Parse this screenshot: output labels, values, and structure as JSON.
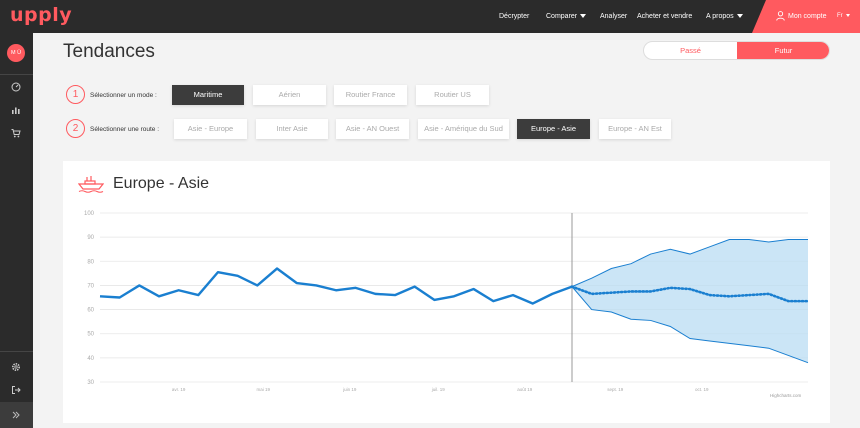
{
  "app": {
    "logo": "upply"
  },
  "topnav": {
    "items": [
      {
        "label": "Décrypter",
        "dropdown": false
      },
      {
        "label": "Comparer",
        "dropdown": true
      },
      {
        "label": "Analyser",
        "dropdown": false
      },
      {
        "label": "Acheter et vendre",
        "dropdown": false
      },
      {
        "label": "A propos",
        "dropdown": true
      }
    ],
    "account_label": "Mon compte",
    "language": "Fr"
  },
  "sidebar": {
    "avatar_initials": "M Ü",
    "icons": [
      "speedometer-icon",
      "bar-chart-icon",
      "cart-icon",
      "settings-icon",
      "logout-icon",
      "expand-icon"
    ]
  },
  "page": {
    "title": "Tendances"
  },
  "period_toggle": {
    "past_label": "Passé",
    "future_label": "Futur",
    "selected": "Futur"
  },
  "mode_selector": {
    "step": "1",
    "label": "Sélectionner un mode :",
    "options": [
      "Maritime",
      "Aérien",
      "Routier France",
      "Routier US"
    ],
    "selected": "Maritime"
  },
  "route_selector": {
    "step": "2",
    "label": "Sélectionner une route :",
    "options": [
      "Asie - Europe",
      "Inter Asie",
      "Asie - AN Ouest",
      "Asie - Amérique du Sud",
      "Europe - Asie",
      "Europe - AN Est"
    ],
    "selected": "Europe - Asie"
  },
  "chart_card": {
    "title": "Europe - Asie",
    "credit": "Highcharts.com"
  },
  "colors": {
    "accent": "#ff5a5f",
    "series": "#1a7fd0",
    "band": "#b9dcf3",
    "dark": "#2b2b2b"
  },
  "chart_data": {
    "type": "line",
    "title": "Europe - Asie",
    "ylim": [
      30,
      100
    ],
    "y_ticks": [
      30,
      40,
      50,
      60,
      70,
      80,
      90,
      100
    ],
    "xlim": [
      0,
      36
    ],
    "x_ticks": [
      {
        "x": 4,
        "label": "avr. 19"
      },
      {
        "x": 8.3,
        "label": "mai 19"
      },
      {
        "x": 12.7,
        "label": "juin 19"
      },
      {
        "x": 17.2,
        "label": "juil. 19"
      },
      {
        "x": 21.6,
        "label": "août 19"
      },
      {
        "x": 26.2,
        "label": "sept. 19"
      },
      {
        "x": 30.6,
        "label": "oct. 19"
      }
    ],
    "forecast_start_x": 24,
    "series": [
      {
        "style": "solid",
        "x": [
          0,
          1,
          2,
          3,
          4,
          5,
          6,
          7,
          8,
          9,
          10,
          11,
          12,
          13,
          14,
          15,
          16,
          17,
          18,
          19,
          20,
          21,
          22,
          23,
          24
        ],
        "values": [
          65.5,
          65,
          70,
          65.5,
          68,
          66,
          75.5,
          74,
          70,
          77,
          71,
          70,
          68,
          69,
          66.5,
          66,
          69.5,
          64,
          65.5,
          68.5,
          63.5,
          66,
          62.5,
          66.5,
          69.5
        ]
      },
      {
        "style": "dotted",
        "x": [
          24,
          25,
          26,
          27,
          28,
          29,
          30,
          31,
          32,
          33,
          34,
          35,
          36
        ],
        "values": [
          69.5,
          66.5,
          67,
          67.5,
          67.5,
          69,
          68.5,
          66,
          65.5,
          66,
          66.5,
          63.5,
          63.5
        ]
      },
      {
        "style": "band-upper",
        "x": [
          24,
          25,
          26,
          27,
          28,
          29,
          30,
          31,
          32,
          33,
          34,
          35,
          36
        ],
        "values": [
          69.5,
          73,
          77,
          79,
          83,
          85,
          83,
          86,
          89,
          89,
          88,
          89,
          89
        ]
      },
      {
        "style": "band-lower",
        "x": [
          24,
          25,
          26,
          27,
          28,
          29,
          30,
          31,
          32,
          33,
          34,
          35,
          36
        ],
        "values": [
          69.5,
          60,
          59,
          56,
          55.5,
          53,
          48,
          47,
          46,
          45,
          44,
          41,
          38
        ]
      }
    ]
  }
}
